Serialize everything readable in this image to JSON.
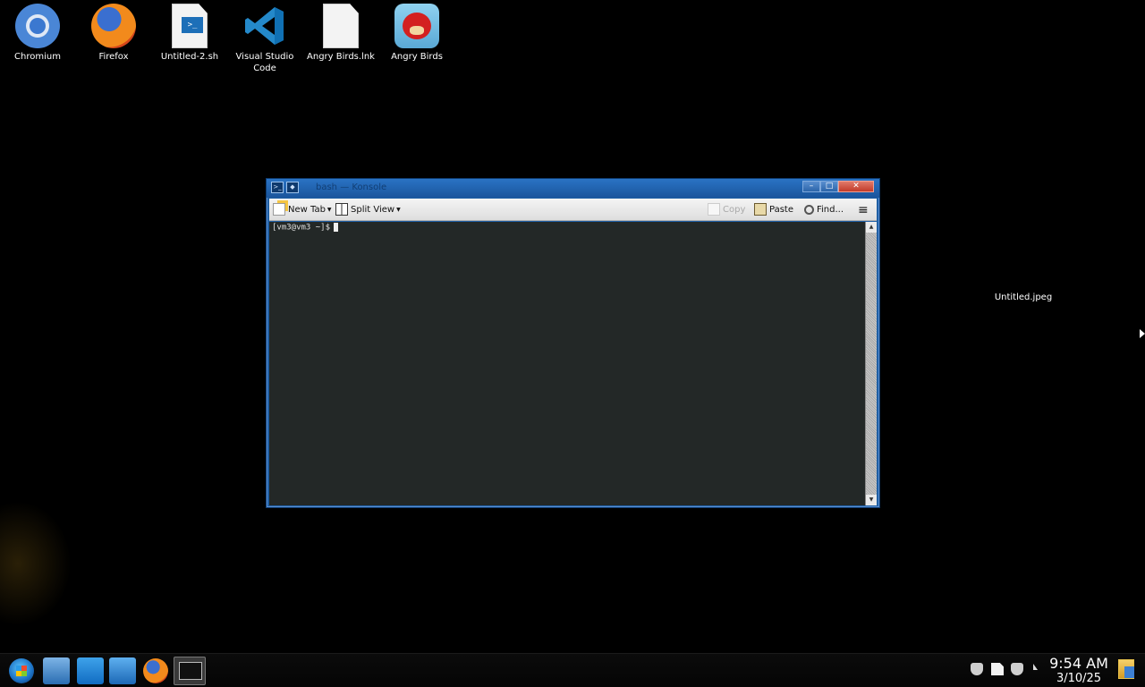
{
  "desktop": {
    "icons": [
      {
        "label": "Chromium",
        "icon": "chromium-icon"
      },
      {
        "label": "Firefox",
        "icon": "firefox-icon"
      },
      {
        "label": "Untitled-2.sh",
        "icon": "shell-script-icon"
      },
      {
        "label": "Visual Studio Code",
        "icon": "vscode-icon"
      },
      {
        "label": "Angry Birds.lnk",
        "icon": "file-icon"
      },
      {
        "label": "Angry Birds",
        "icon": "angry-birds-icon"
      }
    ],
    "floating_file_label": "Untitled.jpeg"
  },
  "window": {
    "title": "bash — Konsole",
    "toolbar": {
      "new_tab": "New Tab",
      "split_view": "Split View",
      "copy": "Copy",
      "paste": "Paste",
      "find": "Find..."
    },
    "terminal": {
      "prompt": "[vm3@vm3 ~]$"
    }
  },
  "taskbar": {
    "pinned": [
      "start-icon",
      "monitor-icon",
      "store-icon",
      "folder-icon",
      "firefox-icon",
      "konsole-icon"
    ],
    "clock": {
      "time": "9:54 AM",
      "date": "3/10/25"
    }
  },
  "colors": {
    "desktop_bg": "#000000",
    "window_frame": "#1f5fa4",
    "terminal_bg": "#232827"
  }
}
